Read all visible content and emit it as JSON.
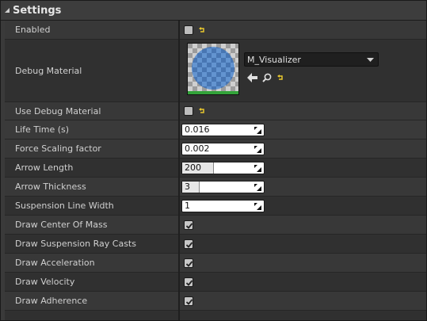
{
  "section": {
    "title": "Settings"
  },
  "rows": {
    "enabled": {
      "label": "Enabled",
      "checked": false
    },
    "debug_material": {
      "label": "Debug Material",
      "value": "M_Visualizer"
    },
    "use_debug_material": {
      "label": "Use Debug Material",
      "checked": false
    },
    "life_time": {
      "label": "Life Time (s)",
      "value": "0.016"
    },
    "force_scaling": {
      "label": "Force Scaling factor",
      "value": "0.002"
    },
    "arrow_length": {
      "label": "Arrow Length",
      "value": "200",
      "slider_fraction": 0.38
    },
    "arrow_thickness": {
      "label": "Arrow Thickness",
      "value": "3",
      "slider_fraction": 0.2
    },
    "suspension_line_width": {
      "label": "Suspension Line Width",
      "value": "1"
    },
    "draw_center_of_mass": {
      "label": "Draw Center Of Mass",
      "checked": true
    },
    "draw_suspension_ray_casts": {
      "label": "Draw Suspension Ray Casts",
      "checked": true
    },
    "draw_acceleration": {
      "label": "Draw Acceleration",
      "checked": true
    },
    "draw_velocity": {
      "label": "Draw Velocity",
      "checked": true
    },
    "draw_adherence": {
      "label": "Draw Adherence",
      "checked": true
    }
  },
  "icons": {
    "reset": "reset-to-default-icon",
    "use_asset": "arrow-left-icon",
    "browse": "search-icon",
    "dropdown": "chevron-down-icon",
    "drag": "drag-resize-icon"
  },
  "colors": {
    "reset_icon": "#e8c72e",
    "material_sphere": "#4f86c6",
    "material_underline": "#33a33a"
  }
}
